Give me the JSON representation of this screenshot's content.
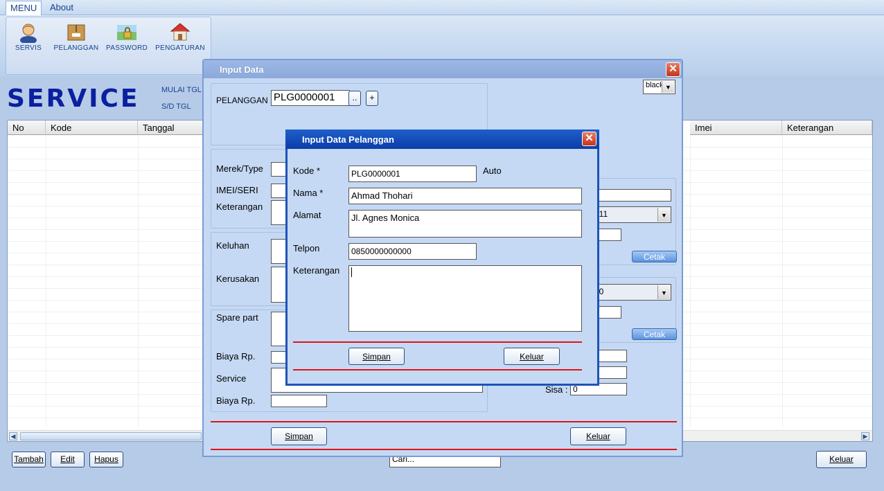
{
  "menubar": {
    "menu_tab": "MENU",
    "about_tab": "About"
  },
  "ribbon": {
    "buttons": [
      {
        "label": "SERVIS",
        "icon": "user-icon"
      },
      {
        "label": "PELANGGAN",
        "icon": "box-icon"
      },
      {
        "label": "PASSWORD",
        "icon": "lock-icon"
      },
      {
        "label": "PENGATURAN",
        "icon": "house-icon"
      }
    ]
  },
  "main": {
    "title": "SERVICE",
    "mulai_label": "MULAI TGL",
    "sd_label": "S/D TGL",
    "grid": {
      "columns": [
        "No",
        "Kode",
        "Tanggal",
        "Imei",
        "Keterangan"
      ]
    },
    "buttons": {
      "tambah": "Tambah",
      "edit": "Edit",
      "hapus": "Hapus",
      "keluar": "Keluar"
    },
    "search_value": "Cari..."
  },
  "input_data": {
    "title": "Input Data",
    "theme_select": "black",
    "pelanggan_label": "PELANGGAN",
    "pelanggan_value": "PLG0000001",
    "browse_btn": "..",
    "add_btn": "+",
    "merek_label": "Merek/Type",
    "imei_label": "IMEI/SERI",
    "keterangan_label": "Keterangan",
    "keluhan_label": "Keluhan",
    "kerusakan_label": "Kerusakan",
    "sparepart_label": "Spare part",
    "biaya1_label": "Biaya Rp.",
    "service_label": "Service",
    "biaya2_label": "Biaya Rp.",
    "date1_partial": "011",
    "date2_partial": "10",
    "cetak1": "Cetak",
    "cetak2": "Cetak",
    "sisa_label": "Sisa :",
    "sisa_value": "0",
    "simpan": "Simpan",
    "keluar": "Keluar"
  },
  "dialog": {
    "title": "Input Data Pelanggan",
    "kode_label": "Kode *",
    "kode_value": "PLG0000001",
    "auto_label": "Auto",
    "nama_label": "Nama *",
    "nama_value": "Ahmad Thohari",
    "alamat_label": "Alamat",
    "alamat_value": "Jl. Agnes Monica",
    "telpon_label": "Telpon",
    "telpon_value": "0850000000000",
    "keterangan_label": "Keterangan",
    "keterangan_value": "",
    "simpan": "Simpan",
    "keluar": "Keluar"
  }
}
